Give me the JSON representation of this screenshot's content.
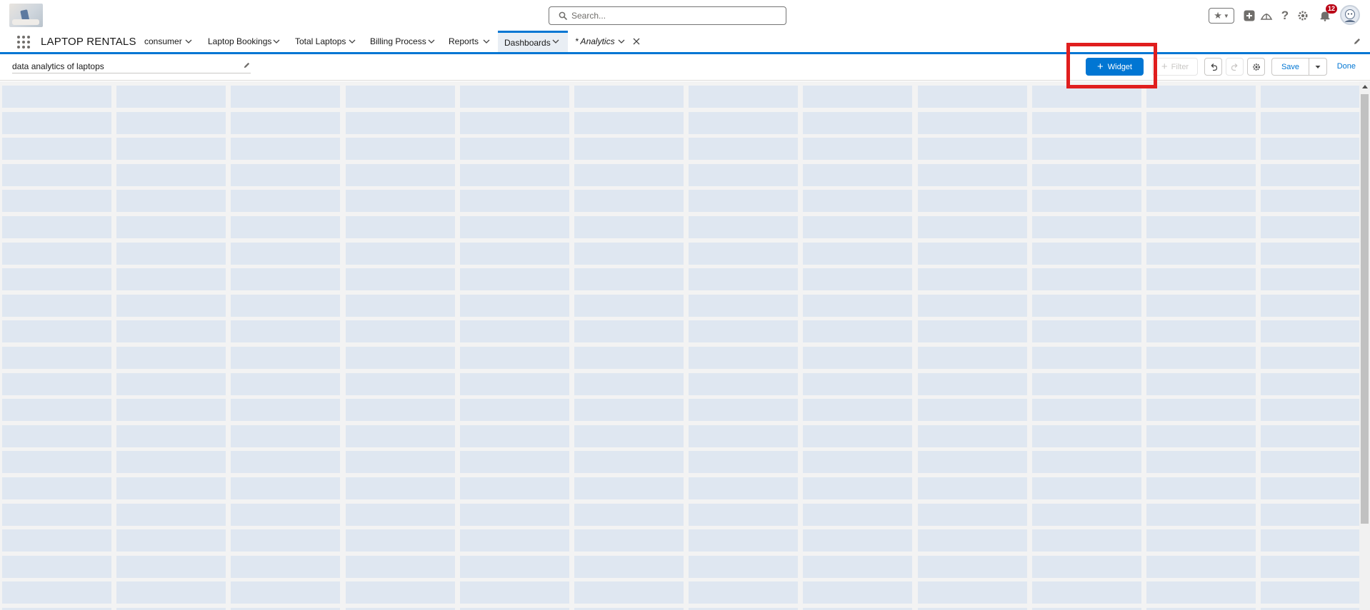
{
  "header": {
    "search_placeholder": "Search...",
    "notification_count": "12"
  },
  "nav": {
    "app_name": "LAPTOP RENTALS",
    "tabs": [
      {
        "label": "consumer"
      },
      {
        "label": "Laptop Bookings"
      },
      {
        "label": "Total Laptops"
      },
      {
        "label": "Billing Process"
      },
      {
        "label": "Reports"
      },
      {
        "label": "Dashboards",
        "active": true
      },
      {
        "label": "* Analytics",
        "italic": true
      }
    ]
  },
  "toolbar": {
    "dashboard_title": "data analytics of laptops",
    "widget_label": "Widget",
    "filter_label": "Filter",
    "save_label": "Save",
    "done_label": "Done"
  },
  "colors": {
    "brand": "#0176d3",
    "grid_cell": "#dfe7f1",
    "highlight": "#e01e1e",
    "badge": "#ba0517"
  }
}
